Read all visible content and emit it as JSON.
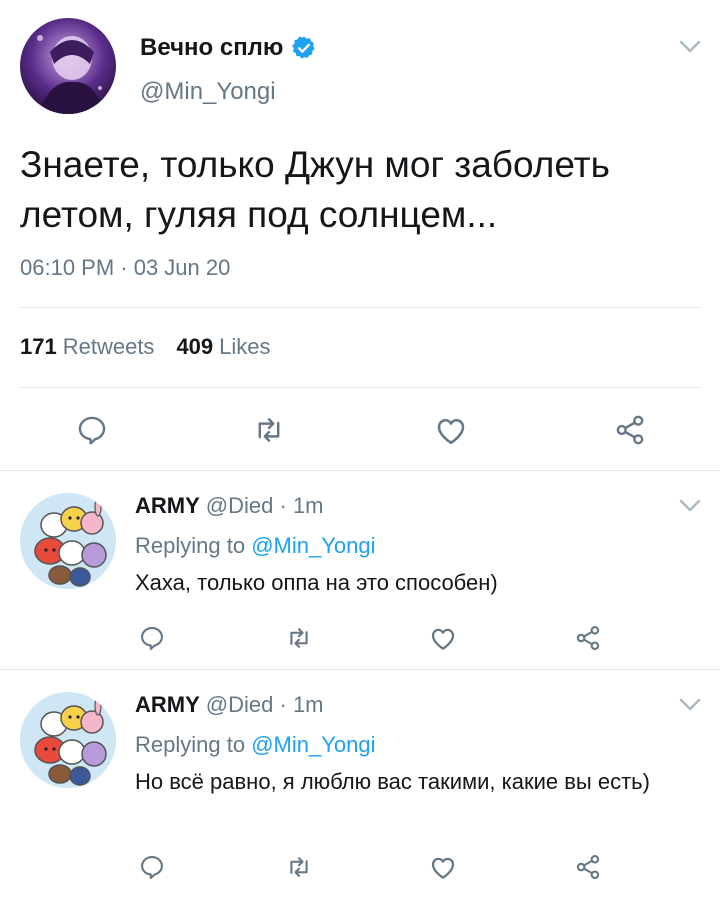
{
  "main_tweet": {
    "display_name": "Вечно сплю",
    "handle": "@Min_Yongi",
    "text": "Знаете, только Джун мог заболеть летом, гуляя под солнцем...",
    "timestamp": "06:10 PM · 03 Jun 20",
    "retweets_count": "171",
    "retweets_label": "Retweets",
    "likes_count": "409",
    "likes_label": "Likes",
    "verified": true
  },
  "replies": [
    {
      "display_name": "ARMY",
      "handle": "@Died",
      "time": "· 1m",
      "replying_prefix": "Replying to",
      "replying_to": "@Min_Yongi",
      "text": "Хаха, только оппа на это способен)"
    },
    {
      "display_name": "ARMY",
      "handle": "@Died",
      "time": "· 1m",
      "replying_prefix": "Replying to",
      "replying_to": "@Min_Yongi",
      "text": "Но всё равно, я люблю вас такими, какие вы есть)"
    }
  ],
  "icons": [
    "reply-icon",
    "retweet-icon",
    "like-icon",
    "share-icon",
    "chevron-down-icon",
    "verified-badge-icon"
  ],
  "colors": {
    "accent": "#1da1f2",
    "secondary_text": "#657786",
    "divider": "#e1e8ed",
    "icon": "#657786"
  }
}
